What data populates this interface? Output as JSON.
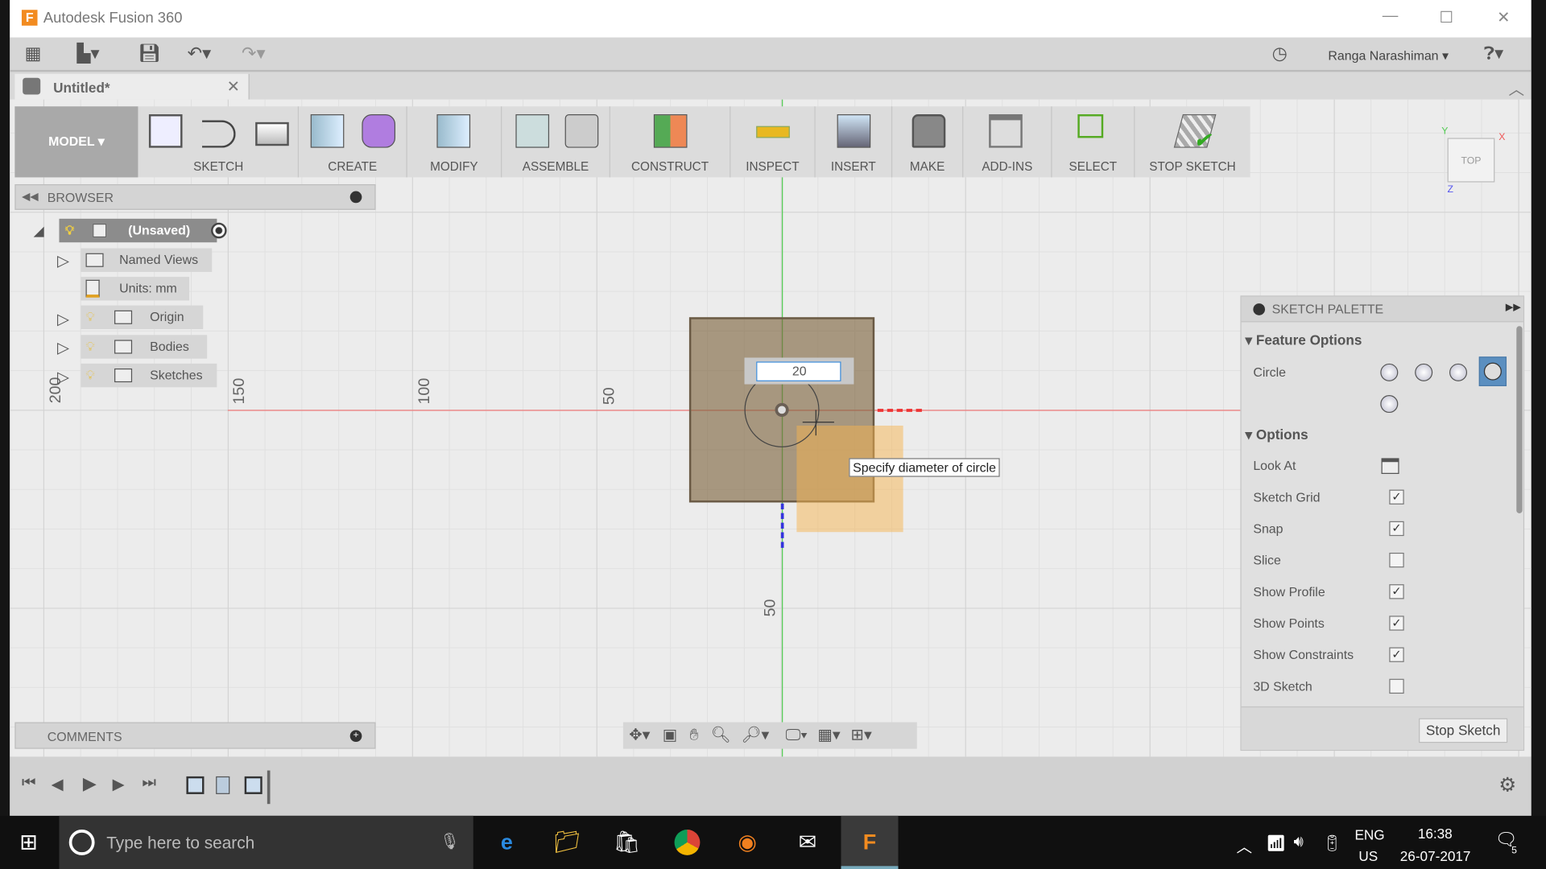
{
  "window": {
    "title": "Autodesk Fusion 360",
    "user": "Ranga Narashiman",
    "document_tab": "Untitled*"
  },
  "ribbon": {
    "workspace": "MODEL",
    "groups": [
      {
        "label": "SKETCH"
      },
      {
        "label": "CREATE"
      },
      {
        "label": "MODIFY"
      },
      {
        "label": "ASSEMBLE"
      },
      {
        "label": "CONSTRUCT"
      },
      {
        "label": "INSPECT"
      },
      {
        "label": "INSERT"
      },
      {
        "label": "MAKE"
      },
      {
        "label": "ADD-INS"
      },
      {
        "label": "SELECT"
      },
      {
        "label": "STOP SKETCH"
      }
    ]
  },
  "browser": {
    "title": "BROWSER",
    "root": "(Unsaved)",
    "items": [
      {
        "label": "Named Views"
      },
      {
        "label": "Units: mm"
      },
      {
        "label": "Origin"
      },
      {
        "label": "Bodies"
      },
      {
        "label": "Sketches"
      }
    ]
  },
  "comments": {
    "title": "COMMENTS"
  },
  "viewcube": {
    "face": "TOP",
    "x": "X",
    "y": "Y",
    "z": "Z"
  },
  "axis_labels": [
    "150",
    "100",
    "50",
    "200",
    "50"
  ],
  "sketch": {
    "diameter_input": "20",
    "tooltip": "Specify diameter of circle"
  },
  "palette": {
    "title": "SKETCH PALETTE",
    "feature_options": "Feature Options",
    "circle_label": "Circle",
    "options": "Options",
    "rows": [
      {
        "label": "Look At",
        "type": "button"
      },
      {
        "label": "Sketch Grid",
        "checked": true
      },
      {
        "label": "Snap",
        "checked": true
      },
      {
        "label": "Slice",
        "checked": false
      },
      {
        "label": "Show Profile",
        "checked": true
      },
      {
        "label": "Show Points",
        "checked": true
      },
      {
        "label": "Show Constraints",
        "checked": true
      },
      {
        "label": "3D Sketch",
        "checked": false
      }
    ],
    "stop_button": "Stop Sketch"
  },
  "taskbar": {
    "search_placeholder": "Type here to search",
    "lang1": "ENG",
    "lang2": "US",
    "time": "16:38",
    "date": "26-07-2017",
    "notifications": "5"
  },
  "colors": {
    "x_axis": "#e04040",
    "y_axis": "#40c040",
    "sketch_profile": "#8a7552",
    "highlight": "#f5c67a",
    "palette_active": "#5b8fc0"
  }
}
